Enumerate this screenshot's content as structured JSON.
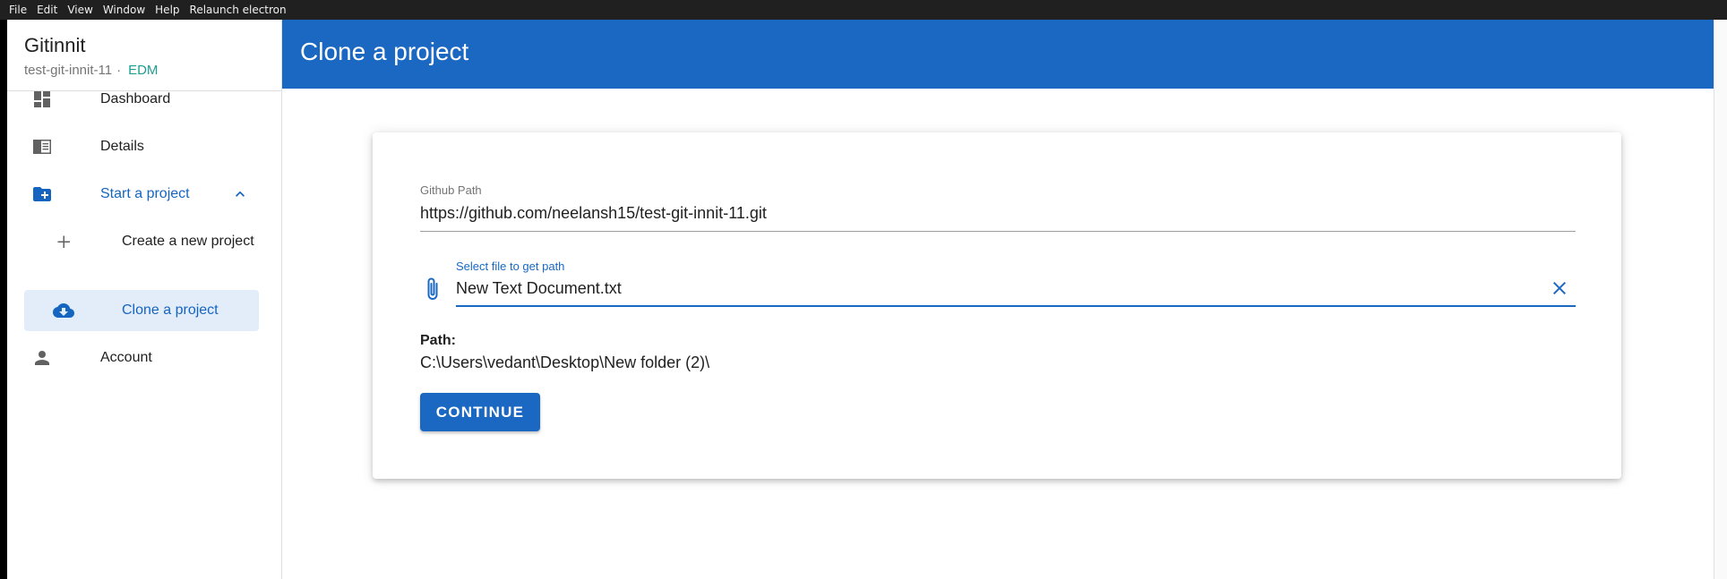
{
  "menubar": {
    "items": [
      "File",
      "Edit",
      "View",
      "Window",
      "Help",
      "Relaunch electron"
    ]
  },
  "app": {
    "title": "Gitinnit",
    "repo": "test-git-innit-11",
    "separator": "·",
    "badge": "EDM"
  },
  "sidebar": {
    "items": [
      {
        "label": "Dashboard",
        "icon": "dashboard-icon"
      },
      {
        "label": "Details",
        "icon": "details-icon"
      },
      {
        "label": "Start a project",
        "icon": "create-folder-icon"
      },
      {
        "label": "Create a new project",
        "icon": "plus-icon"
      },
      {
        "label": "Clone a project",
        "icon": "cloud-download-icon"
      },
      {
        "label": "Account",
        "icon": "person-icon"
      }
    ]
  },
  "header": {
    "title": "Clone a project"
  },
  "form": {
    "github_label": "Github Path",
    "github_value": "https://github.com/neelansh15/test-git-innit-11.git",
    "file_label": "Select file to get path",
    "file_value": "New Text Document.txt",
    "path_label": "Path:",
    "path_value": "C:\\Users\\vedant\\Desktop\\New folder (2)\\",
    "continue_label": "CONTINUE"
  },
  "colors": {
    "primary": "#1a68c2",
    "accent": "#1e9e91",
    "active_bg": "#e3ecf9",
    "icon_gray": "#616161"
  }
}
